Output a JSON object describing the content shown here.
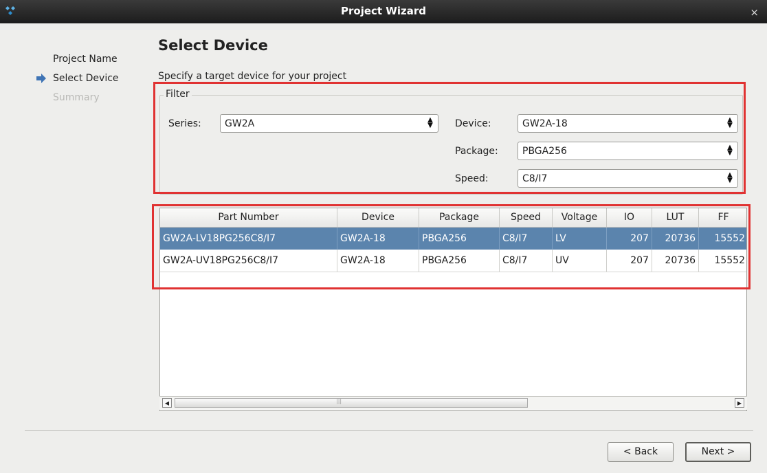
{
  "window": {
    "title": "Project Wizard",
    "close_glyph": "×",
    "app_icon": "gowin-logo-icon",
    "close_icon": "close-icon"
  },
  "nav": {
    "items": [
      {
        "label": "Project Name",
        "state": "done"
      },
      {
        "label": "Select Device",
        "state": "current"
      },
      {
        "label": "Summary",
        "state": "disabled"
      }
    ],
    "current_icon": "arrow-right-icon"
  },
  "page": {
    "title": "Select Device",
    "subtitle": "Specify a target device for your project"
  },
  "filter": {
    "legend": "Filter",
    "series_label": "Series:",
    "series_value": "GW2A",
    "device_label": "Device:",
    "device_value": "GW2A-18",
    "package_label": "Package:",
    "package_value": "PBGA256",
    "speed_label": "Speed:",
    "speed_value": "C8/I7",
    "spin_glyph": "⇕"
  },
  "table": {
    "columns": [
      "Part Number",
      "Device",
      "Package",
      "Speed",
      "Voltage",
      "IO",
      "LUT",
      "FF"
    ],
    "rows": [
      {
        "part": "GW2A-LV18PG256C8/I7",
        "device": "GW2A-18",
        "package": "PBGA256",
        "speed": "C8/I7",
        "voltage": "LV",
        "io": "207",
        "lut": "20736",
        "ff": "15552",
        "selected": true
      },
      {
        "part": "GW2A-UV18PG256C8/I7",
        "device": "GW2A-18",
        "package": "PBGA256",
        "speed": "C8/I7",
        "voltage": "UV",
        "io": "207",
        "lut": "20736",
        "ff": "15552",
        "selected": false
      }
    ]
  },
  "scrollbar": {
    "left_glyph": "◀",
    "right_glyph": "▶",
    "grip_glyph": "|||"
  },
  "buttons": {
    "back": "< Back",
    "next": "Next >"
  },
  "annotation_color": "#e03232",
  "selection_color": "#5b84ad"
}
